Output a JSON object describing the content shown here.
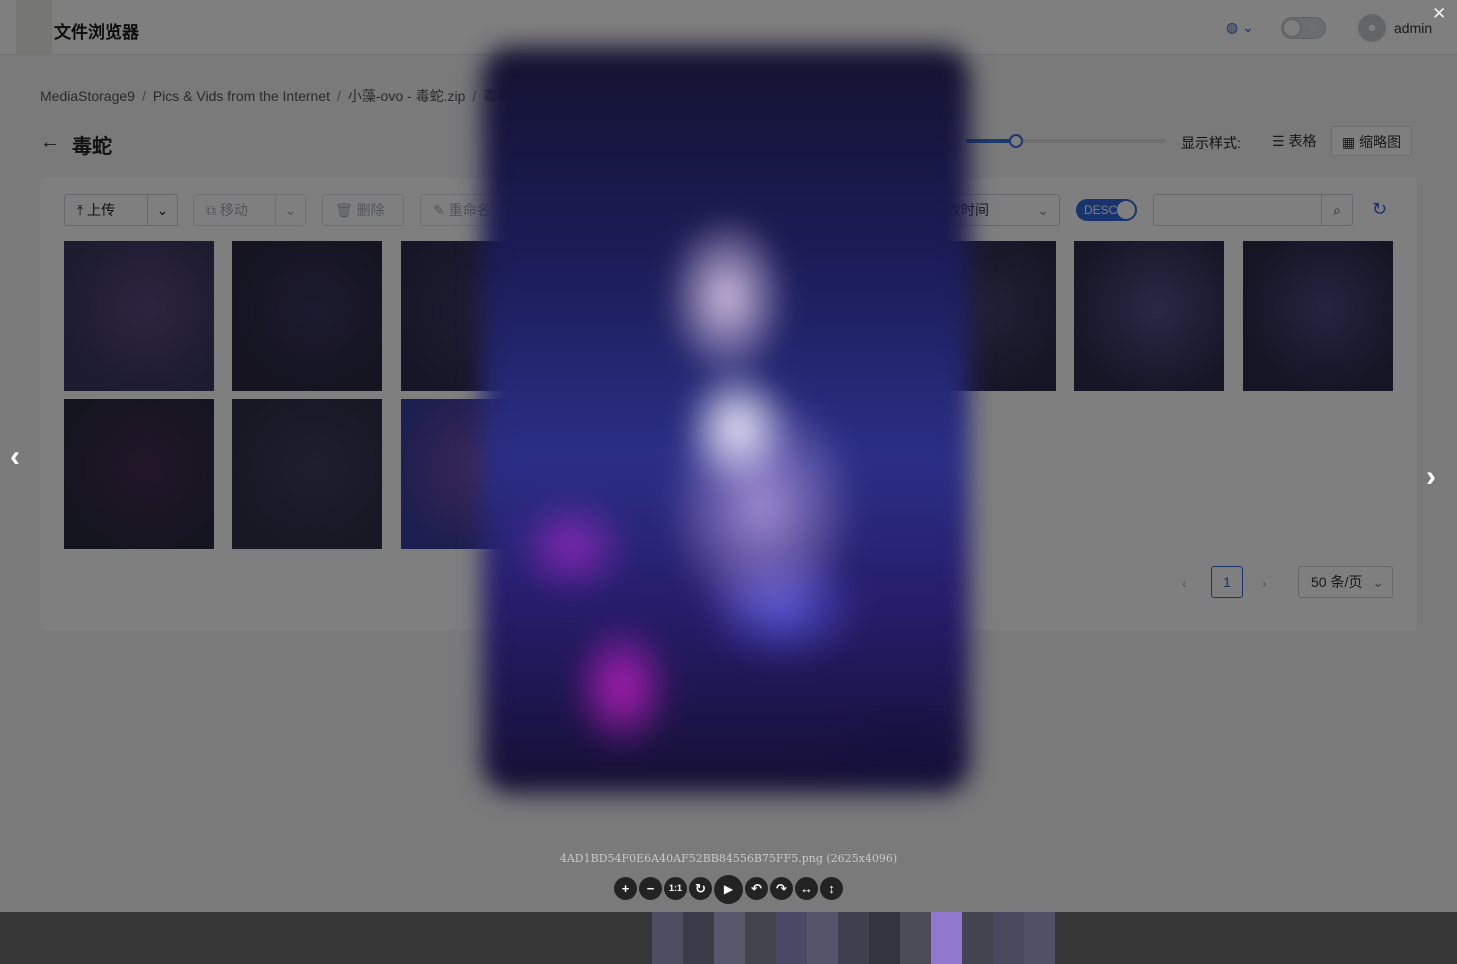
{
  "header": {
    "app_title": "文件浏览器",
    "language_icon": "globe-icon",
    "theme_toggle_icon": "sun-icon",
    "user": "admin"
  },
  "breadcrumb": [
    "MediaStorage9",
    "Pics & Vids from the Internet",
    "小藻-ovo - 毒蛇.zip",
    "毒蛇"
  ],
  "page_title": "毒蛇",
  "thumb_size_label": "1:",
  "thumb_size_level": 0.25,
  "view_style": {
    "label": "显示样式:",
    "table": "表格",
    "thumbnail": "缩略图",
    "selected": "缩略图"
  },
  "toolbar": {
    "upload": "上传",
    "move": "移动",
    "delete": "删除",
    "rename": "重命名"
  },
  "sort": {
    "field": "修改时间",
    "order": "DESC"
  },
  "search": {
    "placeholder": ""
  },
  "thumbnails": [
    {
      "c1": "#3a3760",
      "c2": "#5a4a80"
    },
    {
      "c1": "#2a2840",
      "c2": "#3a3560"
    },
    {
      "c1": "#2f2d50",
      "c2": "#3e3a66"
    },
    {
      "c1": "#2d2b48",
      "c2": "#474070"
    },
    {
      "c1": "#35335a",
      "c2": "#4c4377"
    },
    {
      "c1": "#2c2a4a",
      "c2": "#44416c"
    },
    {
      "c1": "#2e2c4e",
      "c2": "#55508a"
    },
    {
      "c1": "#2b2a48",
      "c2": "#4d4680"
    },
    {
      "c1": "#2a2a40",
      "c2": "#432c50"
    },
    {
      "c1": "#303048",
      "c2": "#3e3c60"
    },
    {
      "c1": "#3a3fa0",
      "c2": "#7a4eb0"
    },
    {
      "c1": "#262540",
      "c2": "#3a3860"
    }
  ],
  "pagination": {
    "current": "1",
    "per_page": "50 条/页"
  },
  "viewer": {
    "caption": "4AD1BD54F0E6A40AF52BB84556B75FF5.png (2625x4096)",
    "buttons": [
      {
        "name": "zoom-in-button",
        "glyph": "+"
      },
      {
        "name": "zoom-out-button",
        "glyph": "−"
      },
      {
        "name": "one-to-one-button",
        "glyph": "1:1"
      },
      {
        "name": "reset-button",
        "glyph": "↻"
      },
      {
        "name": "play-button",
        "glyph": "▶"
      },
      {
        "name": "rotate-left-button",
        "glyph": "↶"
      },
      {
        "name": "rotate-right-button",
        "glyph": "↷"
      },
      {
        "name": "flip-horizontal-button",
        "glyph": "↔"
      },
      {
        "name": "flip-vertical-button",
        "glyph": "↕"
      }
    ],
    "close_glyph": "✕",
    "prev_glyph": "‹",
    "next_glyph": "›",
    "navbar_colors": [
      "#6a6a9a",
      "#404060",
      "#8080b0",
      "#555566",
      "#6060a0",
      "#7777aa",
      "#4a4a6a",
      "#333350",
      "#666680",
      "#9a80e0",
      "#555570",
      "#606090",
      "#7070a0"
    ]
  },
  "colors": {
    "accent": "#2f6bd8",
    "mask": "rgba(0,0,0,0.5)"
  }
}
